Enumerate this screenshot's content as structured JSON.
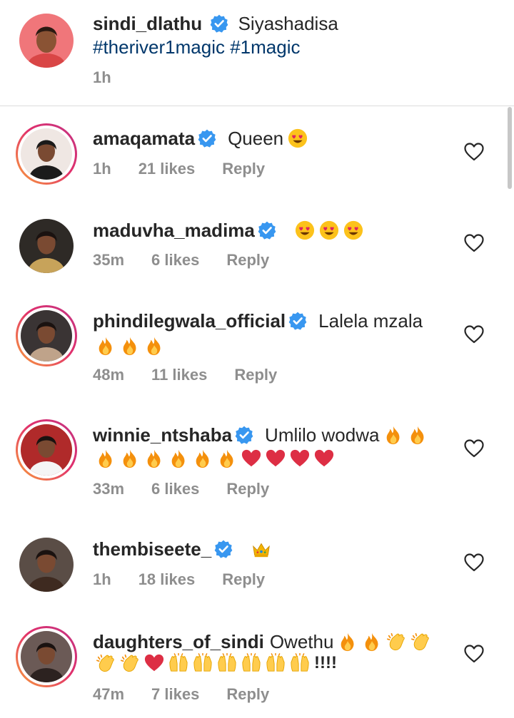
{
  "post": {
    "username": "sindi_dlathu",
    "caption": "Siyashadisa",
    "hashtags": "#theriver1magic #1magic",
    "time": "1h"
  },
  "comments": [
    {
      "username": "amaqamata",
      "text": "Queen",
      "emojis_inline": [
        "heart-eyes"
      ],
      "time": "1h",
      "likes": "21 likes",
      "reply": "Reply",
      "ring": true
    },
    {
      "username": "maduvha_madima",
      "text": "",
      "emojis_inline": [
        "heart-eyes",
        "heart-eyes",
        "heart-eyes"
      ],
      "time": "35m",
      "likes": "6 likes",
      "reply": "Reply",
      "ring": false
    },
    {
      "username": "phindilegwala_official",
      "text": "Lalela mzala",
      "emojis_line2": [
        "fire",
        "fire",
        "fire"
      ],
      "time": "48m",
      "likes": "11 likes",
      "reply": "Reply",
      "ring": true
    },
    {
      "username": "winnie_ntshaba",
      "text": "Umlilo wodwa",
      "emojis_inline": [
        "fire",
        "fire"
      ],
      "emojis_line2": [
        "fire",
        "fire",
        "fire",
        "fire",
        "fire",
        "fire",
        "red-heart",
        "red-heart",
        "red-heart",
        "red-heart"
      ],
      "time": "33m",
      "likes": "6 likes",
      "reply": "Reply",
      "ring": true
    },
    {
      "username": "thembiseete_",
      "text": "",
      "emojis_inline": [
        "crown"
      ],
      "time": "1h",
      "likes": "18 likes",
      "reply": "Reply",
      "ring": false
    },
    {
      "username": "daughters_of_sindi",
      "text": "Owethu",
      "emojis_inline": [
        "fire",
        "fire",
        "clap",
        "clap"
      ],
      "emojis_line2": [
        "clap",
        "clap",
        "red-heart",
        "raised-hands",
        "raised-hands",
        "raised-hands",
        "raised-hands",
        "raised-hands",
        "raised-hands"
      ],
      "line2_suffix": "!!!!",
      "time": "47m",
      "likes": "7 likes",
      "reply": "Reply",
      "ring": true
    }
  ],
  "icons": {
    "verified": "verified-badge-icon",
    "like": "heart-outline-icon"
  },
  "colors": {
    "verified_blue": "#3897f0",
    "meta_gray": "#8e8e8e",
    "hashtag_blue": "#00376b",
    "story_ring_start": "#f9a03a",
    "story_ring_end": "#c13584"
  }
}
